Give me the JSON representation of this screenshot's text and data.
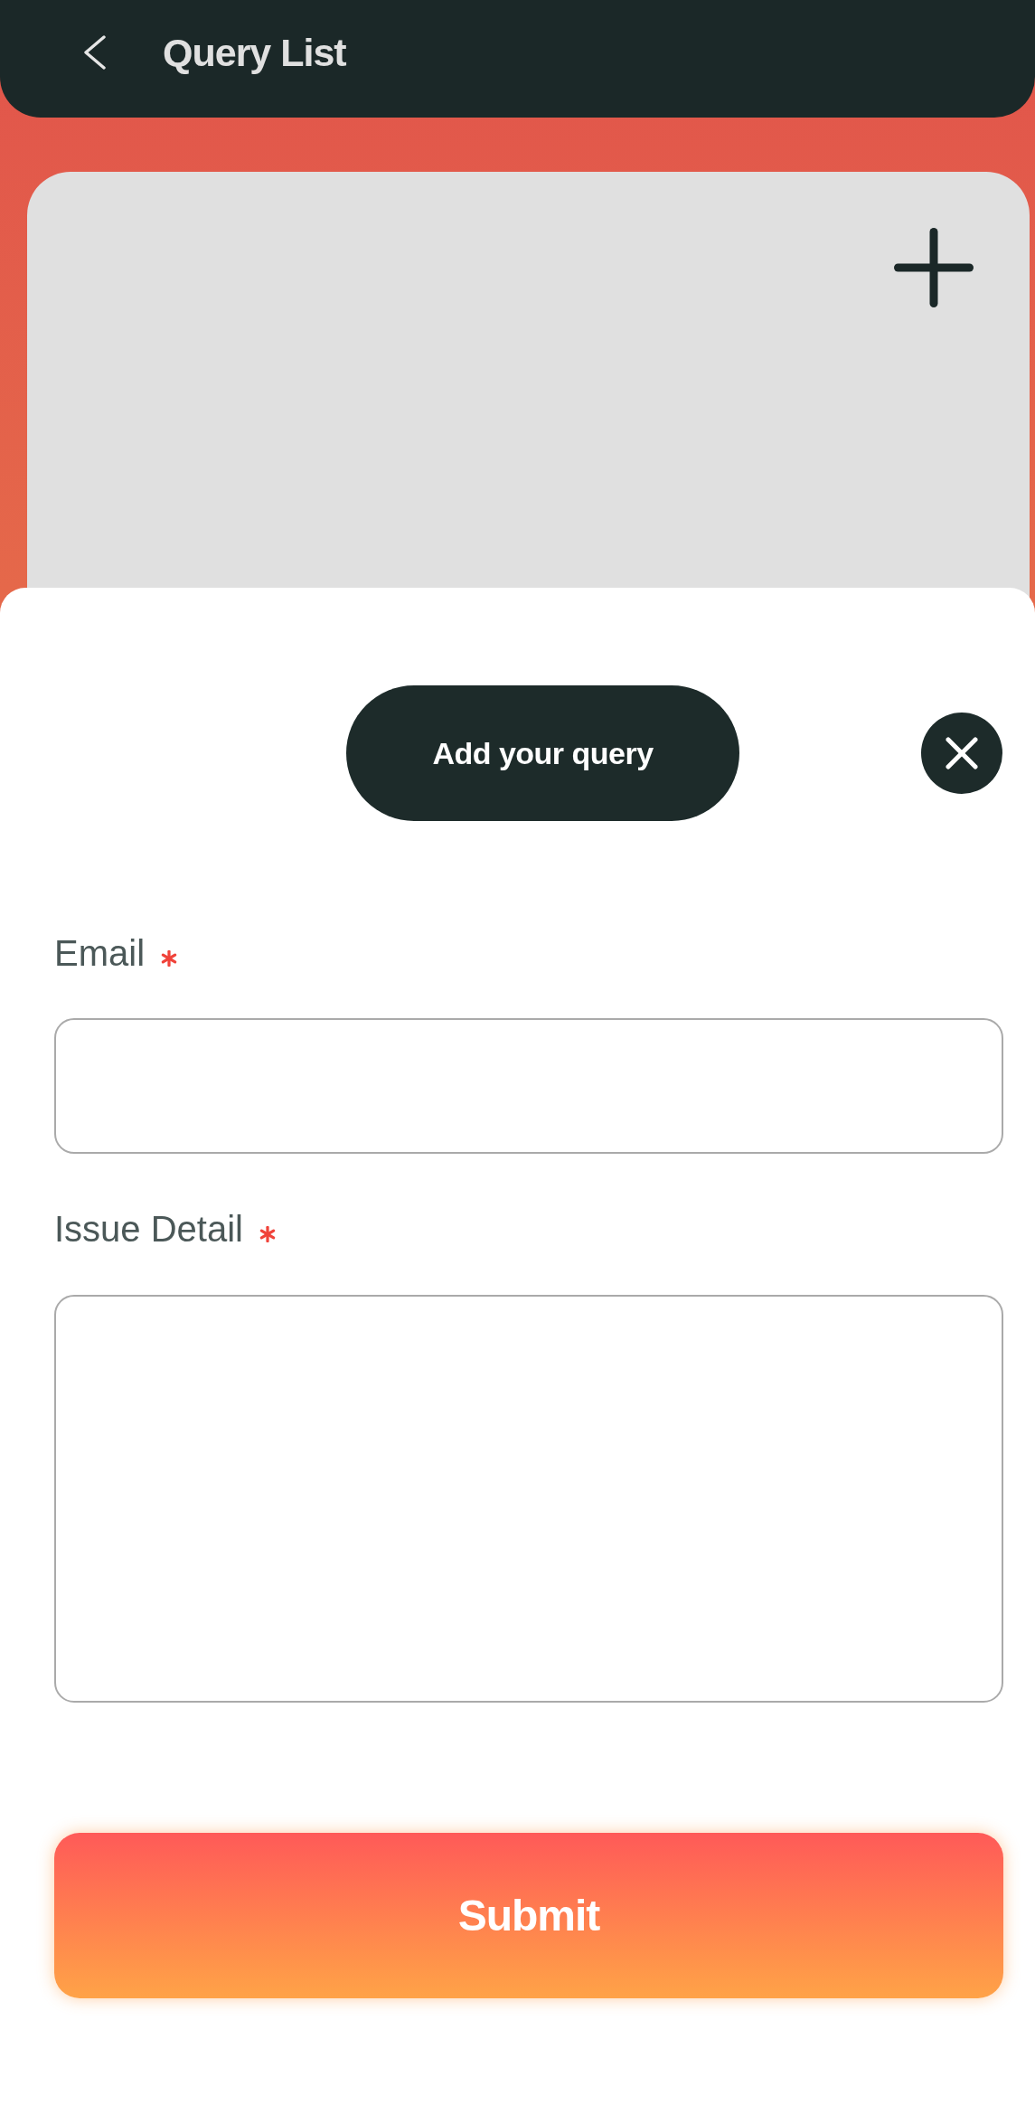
{
  "header": {
    "title": "Query List"
  },
  "sheet": {
    "title": "Add your query"
  },
  "form": {
    "fields": [
      {
        "label": "Email",
        "required": true,
        "kind": "input"
      },
      {
        "label": "Issue Detail",
        "required": true,
        "kind": "textarea"
      }
    ],
    "submit": "Submit"
  }
}
